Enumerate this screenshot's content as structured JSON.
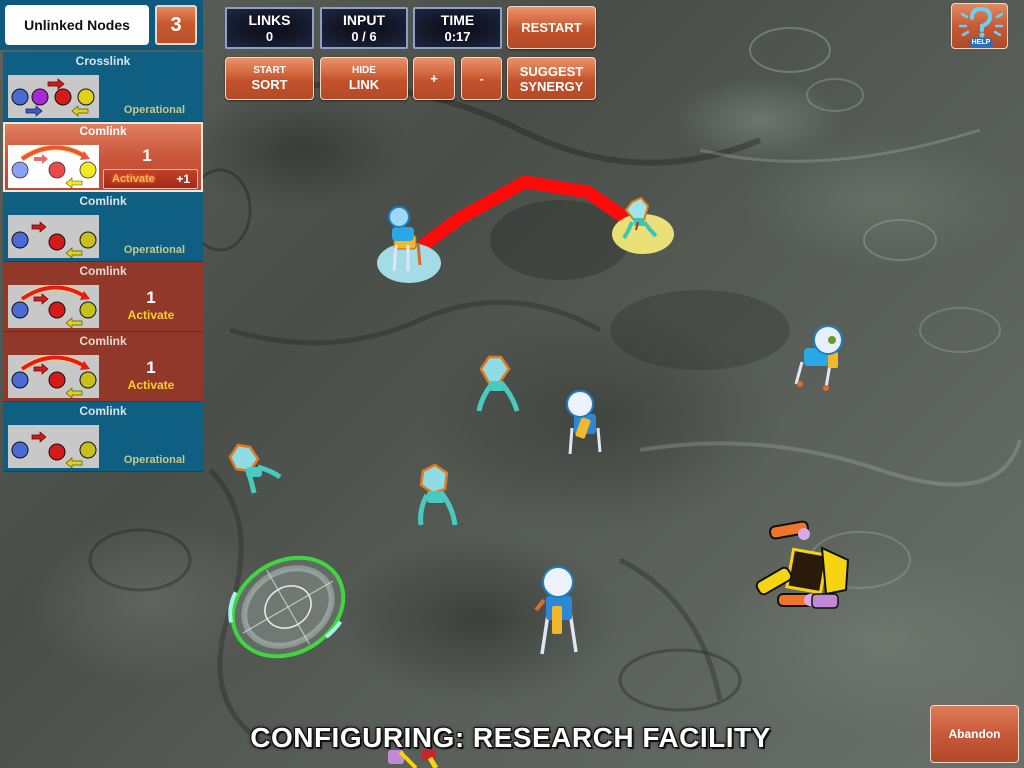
{
  "header": {
    "unlinked_label": "Unlinked Nodes",
    "unlinked_count": "3"
  },
  "cards": [
    {
      "title": "Crosslink",
      "type": "crosslink",
      "state": "operational",
      "status": "Operational"
    },
    {
      "title": "Comlink",
      "type": "comlink-active",
      "state": "selected",
      "count": "1",
      "activate_label": "Activate",
      "bonus": "+1"
    },
    {
      "title": "Comlink",
      "type": "comlink",
      "state": "operational",
      "status": "Operational"
    },
    {
      "title": "Comlink",
      "type": "comlink-active",
      "state": "activate",
      "count": "1",
      "activate_label": "Activate"
    },
    {
      "title": "Comlink",
      "type": "comlink-active",
      "state": "activate",
      "count": "1",
      "activate_label": "Activate"
    },
    {
      "title": "Comlink",
      "type": "comlink",
      "state": "operational",
      "status": "Operational"
    }
  ],
  "stats": {
    "links": {
      "label": "LINKS",
      "value": "0"
    },
    "input": {
      "label": "INPUT",
      "value": "0 / 6"
    },
    "time": {
      "label": "TIME",
      "value": "0:17"
    }
  },
  "buttons": {
    "restart": "RESTART",
    "start_sort": {
      "small": "START",
      "big": "SORT"
    },
    "hide_link": {
      "small": "HIDE",
      "big": "LINK"
    },
    "zoom_in": "+",
    "zoom_out": "-",
    "suggest_synergy": {
      "line1": "SUGGEST",
      "line2": "SYNERGY"
    },
    "help": "HELP",
    "abandon": "Abandon"
  },
  "status_banner": "CONFIGURING: RESEARCH FACILITY",
  "colors": {
    "panel_blue": "#0f5f82",
    "panel_red": "#92382a",
    "button_orange": "#c8593a",
    "link_red": "#ff0000",
    "node_cyan": "#a8e4ec",
    "node_yellow": "#f2e87a",
    "target_green": "#3fd640",
    "status_text": "#c7c88a",
    "activate_text": "#f5d02a"
  },
  "scene": {
    "units": [
      {
        "kind": "astronaut-robot",
        "state": "linked-source"
      },
      {
        "kind": "crystal-alien",
        "state": "linked-target"
      },
      {
        "kind": "astronaut-robot",
        "state": "idle"
      },
      {
        "kind": "crystal-alien",
        "state": "idle"
      },
      {
        "kind": "astronaut-robot",
        "state": "idle"
      },
      {
        "kind": "crystal-alien",
        "state": "idle"
      },
      {
        "kind": "crystal-alien",
        "state": "idle"
      },
      {
        "kind": "astronaut-robot",
        "state": "idle"
      },
      {
        "kind": "yellow-crawler-robot",
        "state": "idle"
      }
    ],
    "link_count_drawn": 1,
    "target_reticle": "visible"
  }
}
